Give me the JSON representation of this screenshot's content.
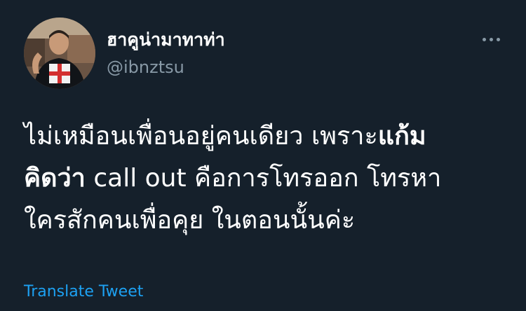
{
  "author": {
    "display_name": "ฮาคูน่ามาทาท่า",
    "handle": "@ibnztsu"
  },
  "tweet": {
    "line1_a": "ไม่เหมือนเพื่อนอยู่คนเดียว เพราะ",
    "line1_b": "แก้ม",
    "line2_a": "คิดว่า",
    "line2_b": " call out คือการโทรออก โทรหา",
    "line3": "ใครสักคนเพื่อคุย ในตอนนั้นค่ะ"
  },
  "actions": {
    "translate_label": "Translate Tweet",
    "more_icon": "more-horizontal-icon"
  },
  "colors": {
    "background": "#15202b",
    "text": "#ffffff",
    "secondary": "#8899a6",
    "link": "#1da1f2"
  }
}
